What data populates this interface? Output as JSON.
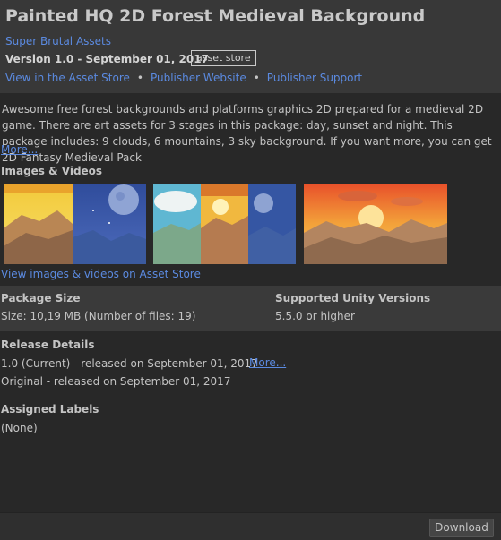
{
  "header": {
    "title": "Painted HQ 2D Forest Medieval Background",
    "publisher": "Super Brutal Assets",
    "version": "Version 1.0 - September 01, 2017",
    "badge": "asset store",
    "links": [
      "View in the Asset Store",
      "Publisher Website",
      "Publisher Support"
    ],
    "separator": "•"
  },
  "description": {
    "text": "Awesome free forest backgrounds and platforms graphics 2D prepared for a medieval 2D game. There are art assets for 3 stages in this package: day, sunset and night. This package includes: 9 clouds, 6 mountains, 3 sky background. If you want more, you can get 2D Fantasy Medieval Pack",
    "more": "More..."
  },
  "images": {
    "title": "Images & Videos",
    "view_link": "View images & videos on Asset Store",
    "thumbnails": [
      "day-night-thumbnail",
      "day-sunset-night-thumbnail",
      "sunset-thumbnail"
    ]
  },
  "package": {
    "size_label": "Package Size",
    "size_value": "Size: 10,19 MB (Number of files: 19)",
    "unity_label": "Supported Unity Versions",
    "unity_value": "5.5.0 or higher"
  },
  "release": {
    "title": "Release Details",
    "current": "1.0 (Current) - released on September 01, 2017",
    "original": "Original - released on September 01, 2017",
    "more": "More..."
  },
  "labels": {
    "title": "Assigned Labels",
    "value": "(None)"
  },
  "footer": {
    "download": "Download"
  },
  "colors": {
    "link": "#5b8ae0",
    "background": "#282828",
    "header": "#383838"
  }
}
